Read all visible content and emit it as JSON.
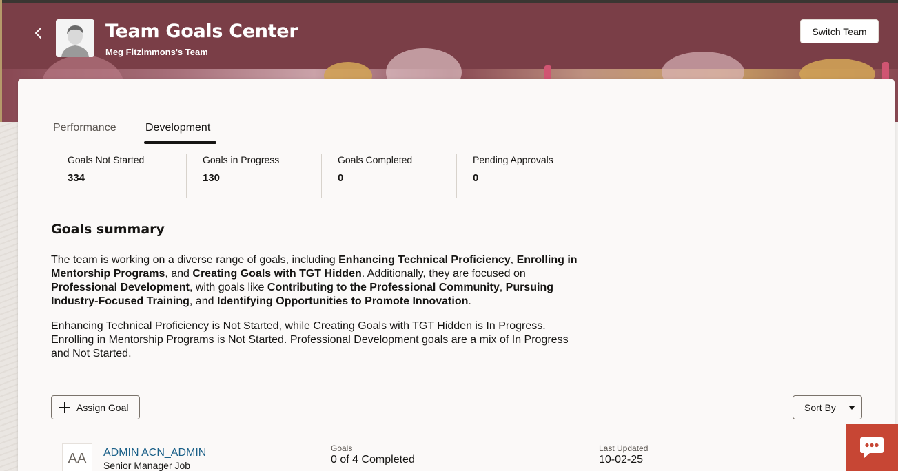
{
  "header": {
    "title": "Team Goals Center",
    "subtitle": "Meg Fitzimmons's Team",
    "switch_label": "Switch Team",
    "bg_color": "#7a3e47"
  },
  "tabs": [
    {
      "label": "Performance",
      "selected": false
    },
    {
      "label": "Development",
      "selected": true
    }
  ],
  "metrics": [
    {
      "label": "Goals Not Started",
      "value": "334"
    },
    {
      "label": "Goals in Progress",
      "value": "130"
    },
    {
      "label": "Goals Completed",
      "value": "0"
    },
    {
      "label": "Pending Approvals",
      "value": "0"
    }
  ],
  "summary": {
    "title": "Goals summary",
    "p1": [
      {
        "t": "The team is working on a diverse range of goals, including ",
        "b": false
      },
      {
        "t": "Enhancing Technical Proficiency",
        "b": true
      },
      {
        "t": ", ",
        "b": false
      },
      {
        "t": "Enrolling in Mentorship Programs",
        "b": true
      },
      {
        "t": ", and ",
        "b": false
      },
      {
        "t": "Creating Goals with TGT Hidden",
        "b": true
      },
      {
        "t": ". Additionally, they are focused on ",
        "b": false
      },
      {
        "t": "Professional Development",
        "b": true
      },
      {
        "t": ", with goals like ",
        "b": false
      },
      {
        "t": "Contributing to the Professional Community",
        "b": true
      },
      {
        "t": ", ",
        "b": false
      },
      {
        "t": "Pursuing Industry-Focused Training",
        "b": true
      },
      {
        "t": ", and ",
        "b": false
      },
      {
        "t": "Identifying Opportunities to Promote Innovation",
        "b": true
      },
      {
        "t": ".",
        "b": false
      }
    ],
    "p2": "Enhancing Technical Proficiency is Not Started, while Creating Goals with TGT Hidden is In Progress. Enrolling in Mentorship Programs is Not Started. Professional Development goals are a mix of In Progress and Not Started."
  },
  "toolbar": {
    "assign_label": "Assign Goal",
    "sort_label": "Sort By"
  },
  "rows": [
    {
      "initials": "AA",
      "name": "ADMIN ACN_ADMIN",
      "job": "Senior Manager Job",
      "goals_label": "Goals",
      "goals_value": "0 of 4 Completed",
      "updated_label": "Last Updated",
      "updated_value": "10-02-25"
    }
  ],
  "colors": {
    "link": "#1b6088",
    "chat": "#c74634"
  }
}
